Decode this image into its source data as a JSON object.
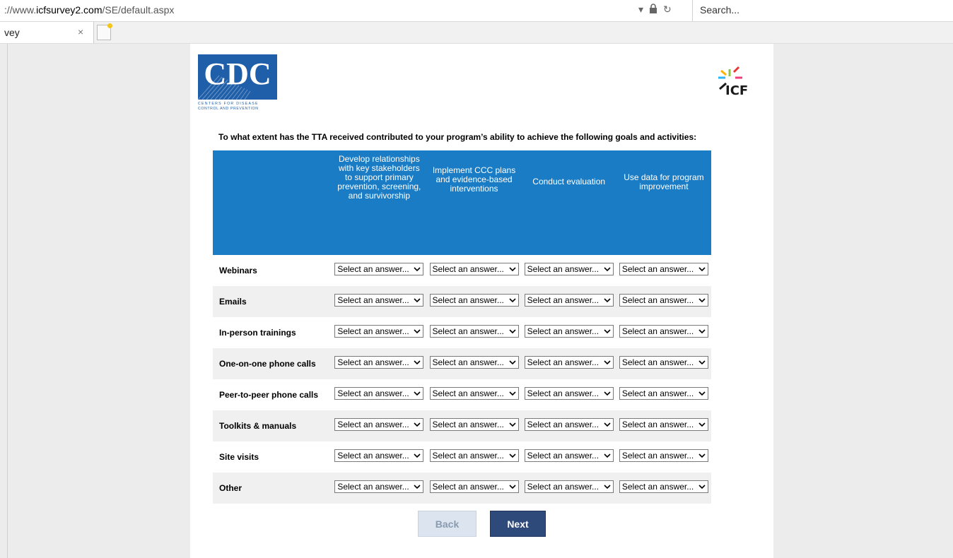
{
  "browser": {
    "url_prefix": "://www.",
    "url_domain": "icfsurvey2.com",
    "url_path": "/SE/default.aspx",
    "search_placeholder": "Search...",
    "tab_title": "vey",
    "tab_close": "×"
  },
  "logos": {
    "cdc_text": "CDC",
    "cdc_subtitle_1": "CENTERS FOR DISEASE",
    "cdc_subtitle_2": "CONTROL AND PREVENTION",
    "icf_text": "ICF"
  },
  "question": "To what extent has the TTA received contributed to your program’s ability to achieve the following goals and activities:",
  "columns": [
    "Develop relationships with key stakeholders to support primary prevention, screening, and survivorship",
    "Implement CCC plans and evidence-based interventions",
    "Conduct evaluation",
    "Use data for program improvement"
  ],
  "rows": [
    "Webinars",
    "Emails",
    "In-person trainings",
    "One-on-one phone calls",
    "Peer-to-peer phone calls",
    "Toolkits & manuals",
    "Site visits",
    "Other"
  ],
  "select_value": "Select an answer...",
  "buttons": {
    "back": "Back",
    "next": "Next"
  },
  "colors": {
    "header_blue": "#1a7cc4",
    "cdc_blue": "#1f5ea8",
    "next_button": "#2d4a7a",
    "back_button": "#dbe4ef"
  }
}
